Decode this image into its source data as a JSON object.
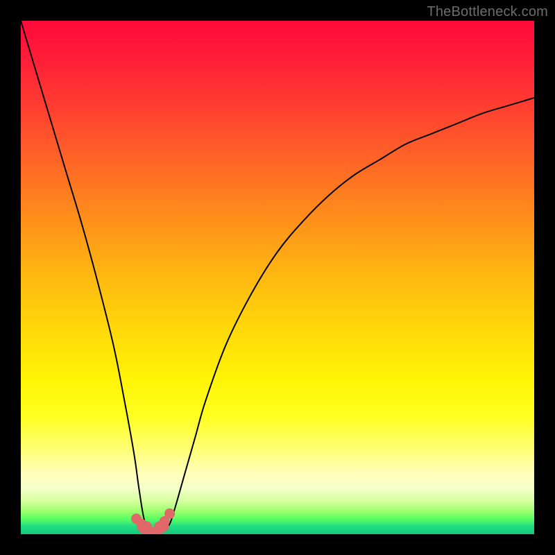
{
  "watermark": "TheBottleneck.com",
  "colors": {
    "curve": "#000000",
    "marker": "#e06868",
    "frame_bg_top": "#ff0a3b",
    "frame_bg_bottom": "#13c97e",
    "page_bg": "#000000"
  },
  "chart_data": {
    "type": "line",
    "title": "",
    "xlabel": "",
    "ylabel": "",
    "xlim": [
      0,
      100
    ],
    "ylim": [
      0,
      100
    ],
    "grid": false,
    "series": [
      {
        "name": "bottleneck-curve",
        "x": [
          0,
          3,
          6,
          9,
          12,
          15,
          18,
          20,
          22,
          23,
          24,
          25,
          26,
          27,
          28,
          29,
          30,
          32,
          34,
          36,
          40,
          45,
          50,
          55,
          60,
          65,
          70,
          75,
          80,
          85,
          90,
          95,
          100
        ],
        "values": [
          100,
          90,
          80,
          70,
          60,
          49,
          37,
          27,
          16,
          9,
          3,
          1,
          0,
          0,
          1,
          2,
          5,
          12,
          19,
          26,
          37,
          47,
          55,
          61,
          66,
          70,
          73,
          76,
          78,
          80,
          82,
          83.5,
          85
        ]
      }
    ],
    "markers": {
      "name": "highlighted-range",
      "x": [
        22.5,
        23.5,
        24.5,
        27.0,
        28.0,
        29.0
      ],
      "values": [
        3.0,
        2.0,
        1.5,
        1.5,
        2.5,
        4.0
      ]
    },
    "thick_segment": {
      "name": "optimal-band",
      "x": [
        23.5,
        25.0,
        26.5,
        28.0
      ],
      "values": [
        1.3,
        0.5,
        0.6,
        1.5
      ]
    }
  }
}
